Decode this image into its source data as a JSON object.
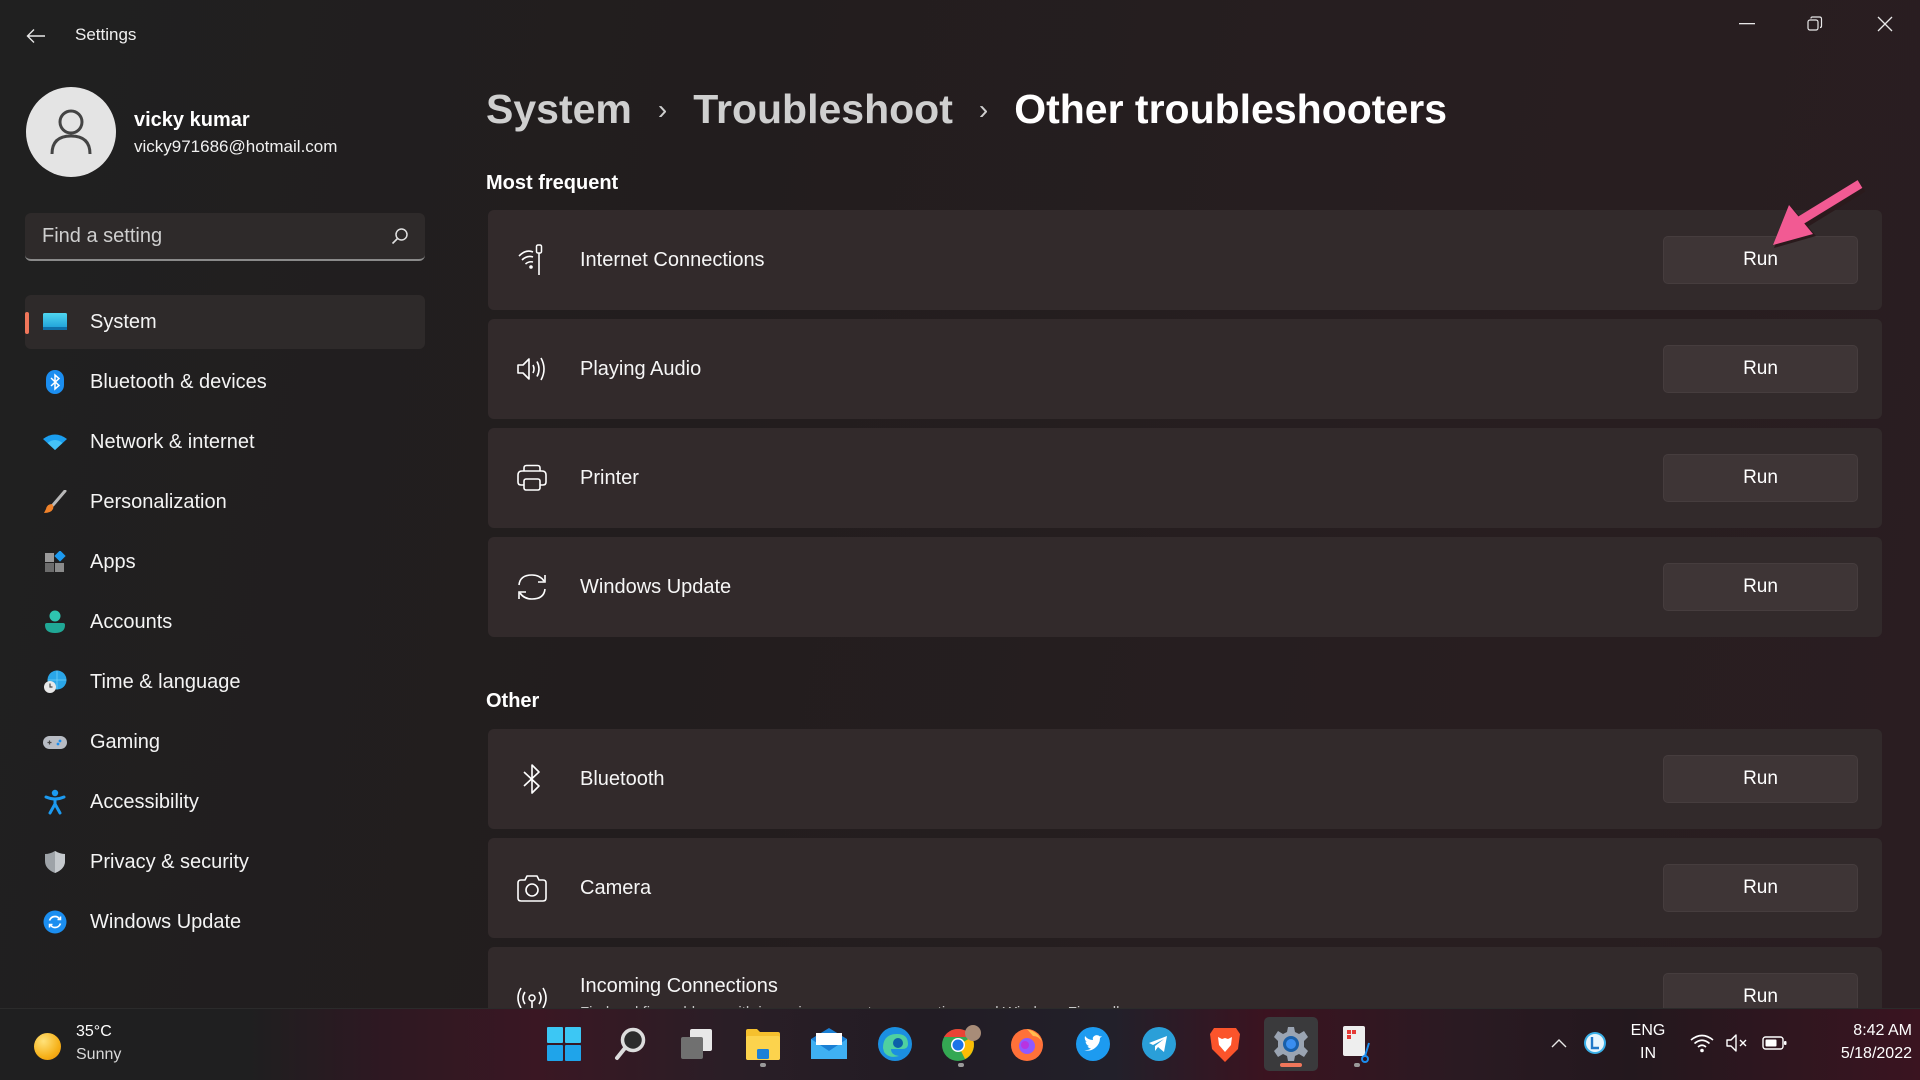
{
  "window": {
    "title": "Settings",
    "controls": {
      "minimize": "minimize",
      "maximize": "restore",
      "close": "close"
    }
  },
  "profile": {
    "name": "vicky kumar",
    "email": "vicky971686@hotmail.com"
  },
  "search": {
    "placeholder": "Find a setting",
    "value": ""
  },
  "sidebar": {
    "active": "System",
    "items": [
      {
        "label": "System",
        "icon": "system-display-icon"
      },
      {
        "label": "Bluetooth & devices",
        "icon": "bluetooth-icon"
      },
      {
        "label": "Network & internet",
        "icon": "wifi-icon"
      },
      {
        "label": "Personalization",
        "icon": "paintbrush-icon"
      },
      {
        "label": "Apps",
        "icon": "apps-icon"
      },
      {
        "label": "Accounts",
        "icon": "person-icon"
      },
      {
        "label": "Time & language",
        "icon": "globe-clock-icon"
      },
      {
        "label": "Gaming",
        "icon": "gamepad-icon"
      },
      {
        "label": "Accessibility",
        "icon": "accessibility-icon"
      },
      {
        "label": "Privacy & security",
        "icon": "shield-icon"
      },
      {
        "label": "Windows Update",
        "icon": "update-icon"
      }
    ]
  },
  "breadcrumb": {
    "items": [
      "System",
      "Troubleshoot"
    ],
    "current": "Other troubleshooters",
    "separator": "›"
  },
  "sections": {
    "most_frequent": {
      "title": "Most frequent",
      "items": [
        {
          "label": "Internet Connections",
          "icon": "internet-connections-icon",
          "button": "Run"
        },
        {
          "label": "Playing Audio",
          "icon": "speaker-icon",
          "button": "Run"
        },
        {
          "label": "Printer",
          "icon": "printer-icon",
          "button": "Run"
        },
        {
          "label": "Windows Update",
          "icon": "sync-icon",
          "button": "Run"
        }
      ]
    },
    "other": {
      "title": "Other",
      "items": [
        {
          "label": "Bluetooth",
          "icon": "bluetooth-icon",
          "button": "Run"
        },
        {
          "label": "Camera",
          "icon": "camera-icon",
          "button": "Run"
        },
        {
          "label": "Incoming Connections",
          "description": "Find and fix problems with incoming computer connections and Windows Firewall.",
          "icon": "antenna-icon",
          "button": "Run"
        }
      ]
    }
  },
  "annotation": {
    "type": "arrow",
    "color": "#f25a93",
    "target": "Internet Connections Run button"
  },
  "taskbar": {
    "weather": {
      "temp": "35°C",
      "condition": "Sunny"
    },
    "apps": [
      {
        "name": "Start",
        "running": false,
        "active": false
      },
      {
        "name": "Search",
        "running": false,
        "active": false
      },
      {
        "name": "Task View",
        "running": false,
        "active": false
      },
      {
        "name": "File Explorer",
        "running": true,
        "active": false
      },
      {
        "name": "Mail",
        "running": false,
        "active": false
      },
      {
        "name": "Microsoft Edge",
        "running": false,
        "active": false
      },
      {
        "name": "Google Chrome",
        "running": true,
        "active": false
      },
      {
        "name": "Firefox",
        "running": false,
        "active": false
      },
      {
        "name": "Twitter",
        "running": false,
        "active": false
      },
      {
        "name": "Telegram",
        "running": false,
        "active": false
      },
      {
        "name": "Brave",
        "running": false,
        "active": false
      },
      {
        "name": "Settings",
        "running": true,
        "active": true
      },
      {
        "name": "Snipping Tool",
        "running": true,
        "active": false
      }
    ],
    "tray": {
      "language_top": "ENG",
      "language_bottom": "IN",
      "time": "8:42 AM",
      "date": "5/18/2022",
      "volume": "muted"
    }
  },
  "colors": {
    "accent": "#f0765a",
    "card_bg": "#322a2b",
    "button_bg": "#3e3536",
    "annotation": "#f25a93"
  }
}
